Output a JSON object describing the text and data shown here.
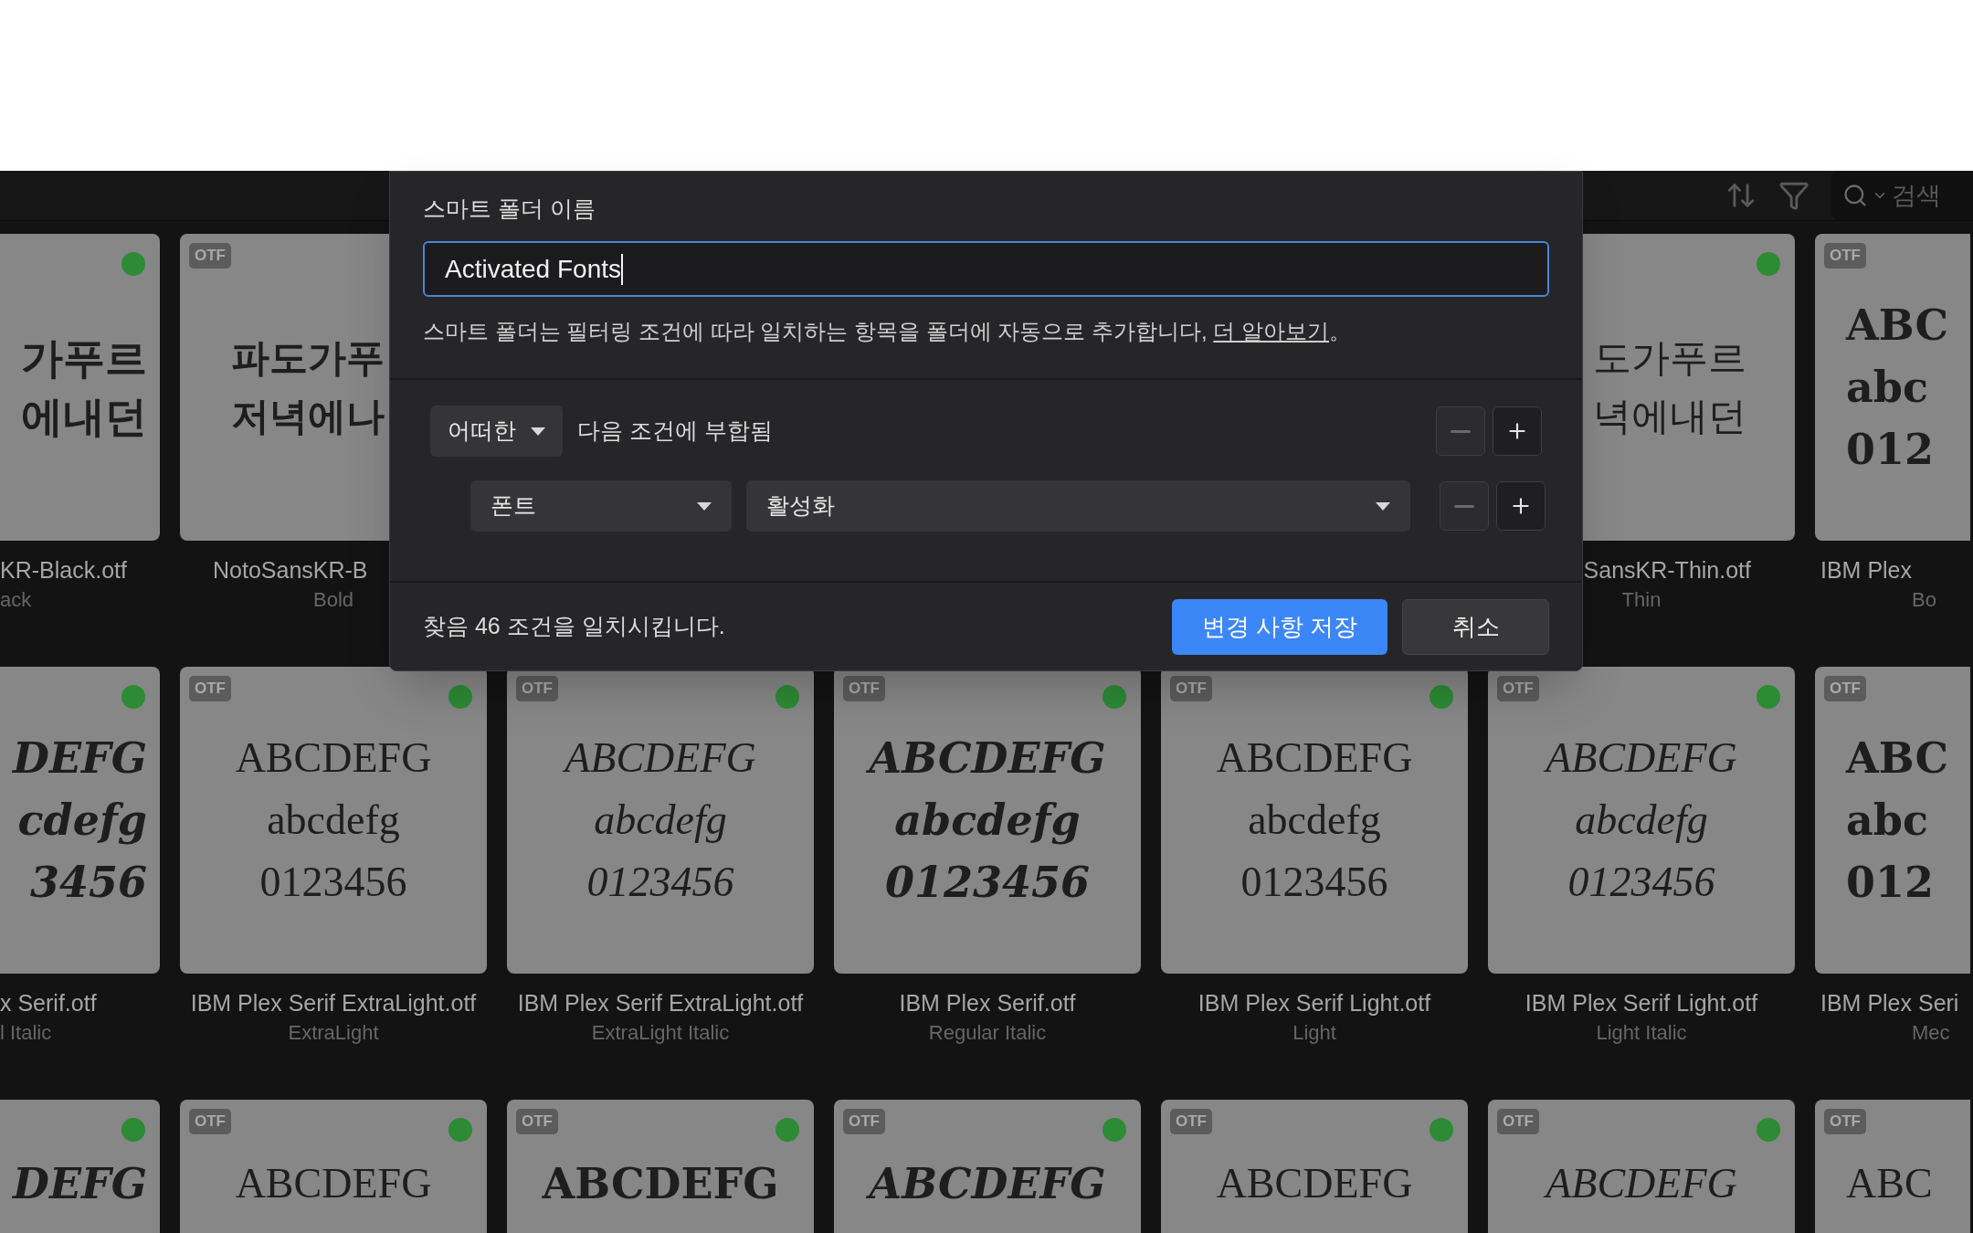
{
  "toolbar": {
    "search": {
      "placeholder": "검색"
    }
  },
  "grid": {
    "rows": [
      {
        "cells": [
          {
            "active": true,
            "kind": "hangul-black",
            "preview": [
              "가푸르",
              "에내던"
            ],
            "name": "KR-Black.otf",
            "style": "ack"
          },
          {
            "badge": "OTF",
            "kind": "hangul-bold",
            "preview": [
              "파도가푸",
              "저녁에나"
            ],
            "name": "NotoSansKR-B",
            "style": "Bold"
          },
          null,
          null,
          null,
          {
            "active": true,
            "kind": "hangul-thin",
            "preview": [
              "도가푸르",
              "녁에내던"
            ],
            "name": "SansKR-Thin.otf",
            "style": "Thin"
          },
          {
            "badge": "OTF",
            "kind": "serif-bold",
            "preview": [
              "ABC",
              "abc",
              "012"
            ],
            "name": "IBM Plex",
            "style": "Bo"
          }
        ]
      },
      {
        "cells": [
          {
            "active": true,
            "kind": "serif-bold-italic",
            "preview": [
              "DEFG",
              "cdefg",
              "3456"
            ],
            "name": "x Serif.otf",
            "style": "l Italic"
          },
          {
            "badge": "OTF",
            "active": true,
            "kind": "serif-thin",
            "preview": [
              "ABCDEFG",
              "abcdefg",
              "0123456"
            ],
            "name": "IBM Plex Serif ExtraLight.otf",
            "style": "ExtraLight"
          },
          {
            "badge": "OTF",
            "active": true,
            "kind": "serif-thin-italic",
            "preview": [
              "ABCDEFG",
              "abcdefg",
              "0123456"
            ],
            "name": "IBM Plex Serif ExtraLight.otf",
            "style": "ExtraLight Italic"
          },
          {
            "badge": "OTF",
            "active": true,
            "kind": "serif-semibold-italic",
            "preview": [
              "ABCDEFG",
              "abcdefg",
              "0123456"
            ],
            "name": "IBM Plex Serif.otf",
            "style": "Regular Italic"
          },
          {
            "badge": "OTF",
            "active": true,
            "kind": "serif-light",
            "preview": [
              "ABCDEFG",
              "abcdefg",
              "0123456"
            ],
            "name": "IBM Plex Serif Light.otf",
            "style": "Light"
          },
          {
            "badge": "OTF",
            "active": true,
            "kind": "serif-light-italic",
            "preview": [
              "ABCDEFG",
              "abcdefg",
              "0123456"
            ],
            "name": "IBM Plex Serif Light.otf",
            "style": "Light Italic"
          },
          {
            "badge": "OTF",
            "kind": "serif-medium",
            "preview": [
              "ABC",
              "abc",
              "012"
            ],
            "name": "IBM Plex Seri",
            "style": "Mec"
          }
        ]
      },
      {
        "cells": [
          {
            "active": true,
            "kind": "serif-bold-italic",
            "preview": [
              "DEFG"
            ]
          },
          {
            "badge": "OTF",
            "active": true,
            "kind": "serif-regular",
            "preview": [
              "ABCDEFG"
            ]
          },
          {
            "badge": "OTF",
            "active": true,
            "kind": "serif-bold",
            "preview": [
              "ABCDEFG"
            ]
          },
          {
            "badge": "OTF",
            "active": true,
            "kind": "serif-bold-italic",
            "preview": [
              "ABCDEFG"
            ]
          },
          {
            "badge": "OTF",
            "active": true,
            "kind": "serif-regular",
            "preview": [
              "ABCDEFG"
            ]
          },
          {
            "badge": "OTF",
            "active": true,
            "kind": "serif-regular-italic",
            "preview": [
              "ABCDEFG"
            ]
          },
          {
            "badge": "OTF",
            "kind": "serif-thin",
            "preview": [
              "ABC"
            ]
          }
        ]
      }
    ]
  },
  "dialog": {
    "name_label": "스마트 폴더 이름",
    "name_value": "Activated Fonts",
    "description": "스마트 폴더는 필터링 조건에 따라 일치하는 항목을 폴더에 자동으로 추가합니다, ",
    "link": "더 알아보기",
    "description_end": "。",
    "match": {
      "select": "어떠한",
      "text": "다음 조건에 부합됨",
      "remove_disabled": true
    },
    "rules": [
      {
        "field": "폰트",
        "value": "활성화",
        "remove_disabled": true
      }
    ],
    "status": "찾음 46 조건을 일치시킵니다.",
    "buttons": [
      {
        "label": "변경 사항 저장",
        "primary": true
      },
      {
        "label": "취소",
        "primary": false
      }
    ]
  }
}
